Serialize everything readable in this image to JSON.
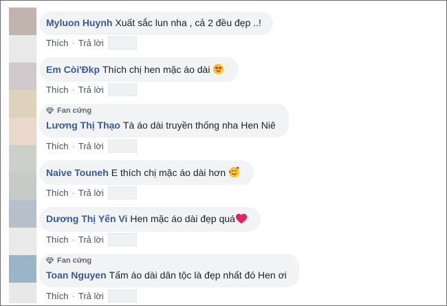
{
  "actions": {
    "like": "Thích",
    "reply": "Trả lời",
    "separator": "·"
  },
  "colors": {
    "name": "#385898",
    "bubble": "#f2f3f5",
    "text": "#1c1e21",
    "meta": "#606770"
  },
  "comments": [
    {
      "name": "Myluon Huynh",
      "text": "Xuất sắc lun nha , cả 2 đều đẹp ..!",
      "badge": "",
      "emoji": ""
    },
    {
      "name": "Em Còi'Đkp",
      "text": "Thích chị hen mặc áo dài",
      "badge": "",
      "emoji": "heart-eyes-emoji"
    },
    {
      "name": "Lương Thị Thạo",
      "text": "Tà áo dài truyền thống nha Hen Niê",
      "badge": "Fan cứng",
      "emoji": ""
    },
    {
      "name": "Naive Touneh",
      "text": "E thích chị mặc áo dài hơn",
      "badge": "",
      "emoji": "smiling-hearts-emoji"
    },
    {
      "name": "Dương Thị Yến Vi",
      "text": "Hen mặc áo dài đẹp quá",
      "badge": "",
      "emoji": "red-heart-emoji"
    },
    {
      "name": "Toan Nguyen",
      "text": "Tấm áo dài dân tộc là đẹp nhất đó Hen ơi",
      "badge": "Fan cứng",
      "emoji": ""
    }
  ]
}
